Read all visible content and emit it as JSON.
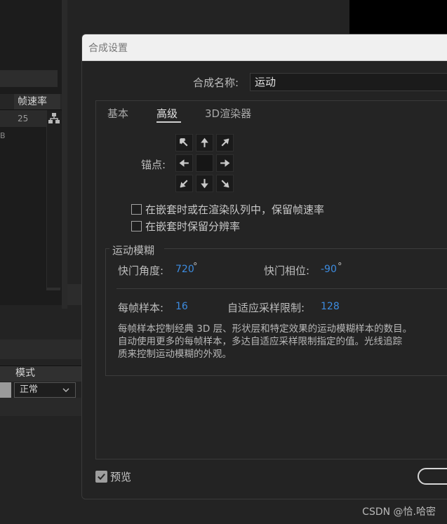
{
  "background": {
    "column_header": "帧速率",
    "row_value": "25",
    "row2_text": "B",
    "mode_header": "模式",
    "mode_value": "正常",
    "mode_chevron_icon": "chevron-down-icon"
  },
  "dialog": {
    "title": "合成设置",
    "comp_name_label": "合成名称:",
    "comp_name_value": "运动",
    "tabs": [
      {
        "label": "基本",
        "active": false
      },
      {
        "label": "高级",
        "active": true
      },
      {
        "label": "3D渲染器",
        "active": false
      }
    ],
    "anchor_label": "锚点:",
    "anchor_icons": [
      "arrow-up-left-icon",
      "arrow-up-icon",
      "arrow-up-right-icon",
      "arrow-left-icon",
      "anchor-center",
      "arrow-right-icon",
      "arrow-down-left-icon",
      "arrow-down-icon",
      "arrow-down-right-icon"
    ],
    "checkboxes": [
      {
        "label": "在嵌套时或在渲染队列中，保留帧速率",
        "checked": false
      },
      {
        "label": "在嵌套时保留分辨率",
        "checked": false
      }
    ],
    "motion_blur": {
      "title": "运动模糊",
      "shutter_angle_label": "快门角度:",
      "shutter_angle_value": "720",
      "shutter_angle_unit": "°",
      "shutter_phase_label": "快门相位:",
      "shutter_phase_value": "-90",
      "shutter_phase_unit": "°",
      "samples_label": "每帧样本:",
      "samples_value": "16",
      "adaptive_label": "自适应采样限制:",
      "adaptive_value": "128",
      "description": [
        "每帧样本控制经典 3D 层、形状层和特定效果的运动模糊样本的数目。",
        "自动使用更多的每帧样本，多达自适应采样限制指定的值。光线追踪",
        "质来控制运动模糊的外观。"
      ]
    },
    "preview_label": "预览",
    "preview_checked": true
  },
  "watermark": "CSDN @恰.哈密",
  "colors": {
    "accent_value": "#3d8ce0",
    "dialog_bg": "#232323",
    "titlebar_bg": "#f0f0f0"
  }
}
